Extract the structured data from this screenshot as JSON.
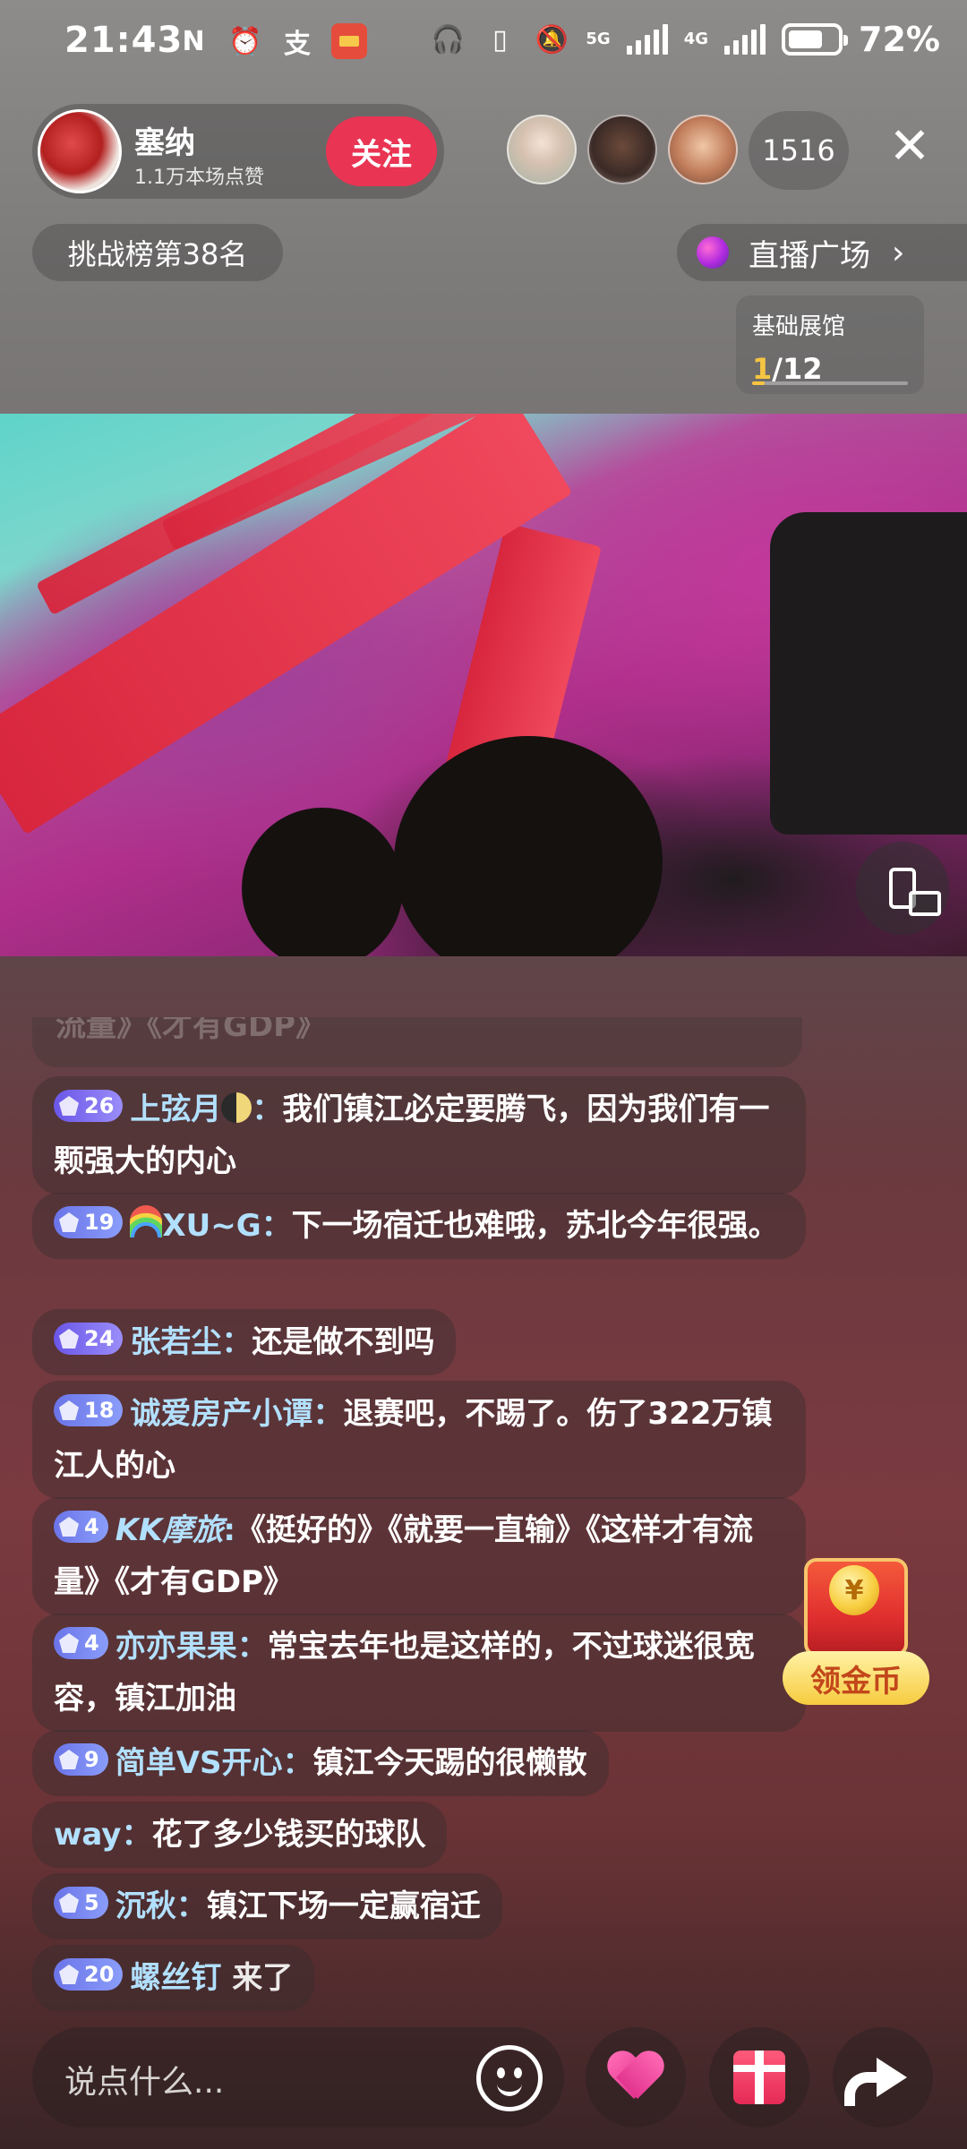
{
  "status_bar": {
    "time": "21:43",
    "left_icons": [
      "nfc-icon",
      "alarm-icon",
      "alipay-icon",
      "app-badge-icon"
    ],
    "network_5g": "5G",
    "network_4g": "4G",
    "battery_percent": "72%",
    "battery_level": 0.72
  },
  "host": {
    "name": "塞纳",
    "likes": "1.1万本场点赞",
    "follow_label": "关注"
  },
  "viewers": {
    "count": "1516"
  },
  "challenge": {
    "rank_label": "挑战榜第38名"
  },
  "plaza": {
    "label": "直播广场",
    "arrow": "›"
  },
  "exhibit": {
    "title": "基础展馆",
    "current": "1",
    "total": "/12",
    "progress": 0.083
  },
  "chat": {
    "faded_text": "流量》《才有GDP》",
    "messages": [
      {
        "level": "26",
        "user": "上弦月",
        "emoji": "moon",
        "sep": "：",
        "text": "我们镇江必定要腾飞，因为我们有一颗强大的内心"
      },
      {
        "level": "19",
        "user": "XU~G",
        "emoji": "rainbow",
        "sep": "：",
        "text": "下一场宿迁也难哦，苏北今年很强。"
      },
      {
        "level": "24",
        "user": "张若尘",
        "sep": "：",
        "text": "还是做不到吗"
      },
      {
        "level": "18",
        "user": "诚爱房产小谭",
        "sep": "：",
        "text": "退赛吧，不踢了。伤了322万镇江人的心"
      },
      {
        "level": "4",
        "user": "KK摩旅",
        "sep": ":",
        "text": "《挺好的》《就要一直输》《这样才有流量》《才有GDP》"
      },
      {
        "level": "4",
        "user": "亦亦果果",
        "sep": "：",
        "text": "常宝去年也是这样的，不过球迷很宽容，镇江加油"
      },
      {
        "level": "9",
        "user": "简单VS开心",
        "sep": "：",
        "text": "镇江今天踢的很懒散"
      },
      {
        "level": "",
        "user": "way",
        "sep": "：",
        "text": "花了多少钱买的球队"
      },
      {
        "level": "5",
        "user": "沉秋",
        "sep": "：",
        "text": "镇江下场一定赢宿迁"
      },
      {
        "level": "20",
        "user": "螺丝钉",
        "sep": " ",
        "text": "来了"
      }
    ]
  },
  "coin": {
    "symbol": "¥",
    "label": "领金币"
  },
  "input": {
    "placeholder": "说点什么..."
  }
}
